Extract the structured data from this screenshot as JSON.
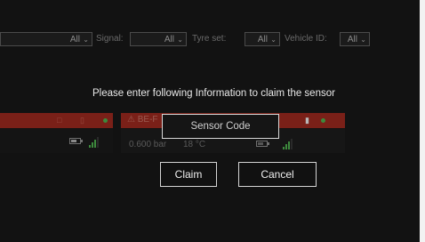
{
  "filters": {
    "first_select_value": "All",
    "signal_label": "Signal:",
    "signal_value": "All",
    "tyre_set_label": "Tyre set:",
    "tyre_set_value": "All",
    "vehicle_id_label": "Vehicle ID:",
    "vehicle_id_value": "All"
  },
  "dialog": {
    "prompt": "Please enter following Information to claim the sensor",
    "sensor_code_placeholder": "Sensor Code",
    "claim_label": "Claim",
    "cancel_label": "Cancel"
  },
  "sensor_card": {
    "name_partial": "BE-F",
    "pressure": "0.600 bar",
    "temperature": "18 °C"
  },
  "colors": {
    "card_header": "#7a2018",
    "status_ok": "#3c8a3c",
    "background": "#121212"
  },
  "icons": [
    "chevron-down-icon",
    "lock-icon",
    "tyre-icon",
    "status-dot-icon",
    "battery-icon",
    "signal-bars-icon",
    "alert-icon"
  ]
}
